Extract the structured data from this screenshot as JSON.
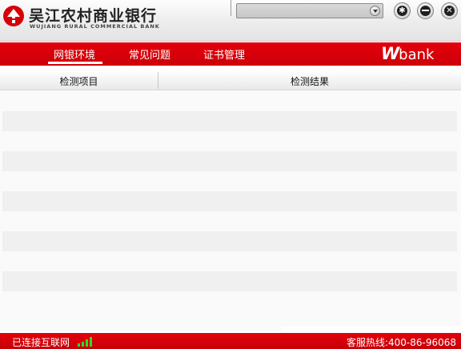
{
  "header": {
    "bank_name": "吴江农村商业银行",
    "bank_name_en": "WUJIANG RURAL COMMERCIAL BANK",
    "address_value": ""
  },
  "nav": {
    "tabs": [
      {
        "label": "网银环境",
        "active": true
      },
      {
        "label": "常见问题",
        "active": false
      },
      {
        "label": "证书管理",
        "active": false
      }
    ],
    "brand_w": "W",
    "brand_rest": "bank"
  },
  "table": {
    "columns": [
      "检测项目",
      "检测结果"
    ],
    "rows": []
  },
  "status": {
    "connection": "已连接互联网",
    "signal_bars": 4,
    "hotline": "客服热线:400-86-96068"
  },
  "colors": {
    "brand_red": "#d6000a",
    "signal_green": "#27e027"
  },
  "icons": [
    "bank-logo-icon",
    "chevron-down-icon",
    "settings-icon",
    "minimize-icon",
    "close-icon",
    "signal-icon"
  ]
}
